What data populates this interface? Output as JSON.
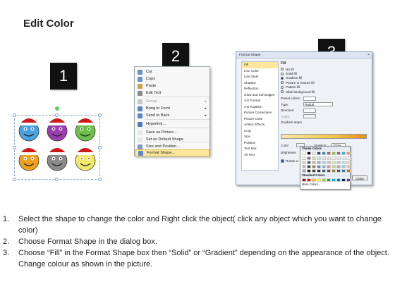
{
  "title": "Edit Color",
  "badges": [
    "1",
    "2",
    "3"
  ],
  "context_menu": {
    "items": [
      {
        "label": "Cut",
        "arrow": false,
        "disabled": false,
        "highlight": false,
        "icon_color": "#6b8fc7"
      },
      {
        "label": "Copy",
        "arrow": false,
        "disabled": false,
        "highlight": false,
        "icon_color": "#6b8fc7"
      },
      {
        "label": "Paste",
        "arrow": false,
        "disabled": false,
        "highlight": false,
        "icon_color": "#c9a34a"
      },
      {
        "label": "Edit Text",
        "arrow": false,
        "disabled": false,
        "highlight": false,
        "icon_color": "#8a8a8a"
      },
      {
        "label": "Group",
        "arrow": true,
        "disabled": true,
        "highlight": false,
        "icon_color": "#c8c8c8"
      },
      {
        "label": "Bring to Front",
        "arrow": true,
        "disabled": false,
        "highlight": false,
        "icon_color": "#5a86c5"
      },
      {
        "label": "Send to Back",
        "arrow": true,
        "disabled": false,
        "highlight": false,
        "icon_color": "#5a86c5"
      },
      {
        "label": "Hyperlink...",
        "arrow": false,
        "disabled": false,
        "highlight": false,
        "icon_color": "#4b7bc0"
      },
      {
        "label": "Save as Picture...",
        "arrow": false,
        "disabled": false,
        "highlight": false,
        "icon_color": "#e8e8e8"
      },
      {
        "label": "Set as Default Shape",
        "arrow": false,
        "disabled": false,
        "highlight": false,
        "icon_color": "#e8e8e8"
      },
      {
        "label": "Size and Position...",
        "arrow": false,
        "disabled": false,
        "highlight": false,
        "icon_color": "#7a9cc6"
      },
      {
        "label": "Format Shape...",
        "arrow": false,
        "disabled": false,
        "highlight": true,
        "icon_color": "#5b8bd2"
      }
    ]
  },
  "format_dialog": {
    "title": "Format Shape",
    "close": "×",
    "categories": [
      "Fill",
      "Line Color",
      "Line Style",
      "Shadow",
      "Reflection",
      "Glow and Soft Edges",
      "3-D Format",
      "3-D Rotation",
      "Picture Corrections",
      "Picture Color",
      "Artistic Effects",
      "Crop",
      "Size",
      "Position",
      "Text Box",
      "Alt Text"
    ],
    "active_category": "Fill",
    "section_heading": "Fill",
    "fill_options": [
      {
        "label": "No fill",
        "selected": false
      },
      {
        "label": "Solid fill",
        "selected": false
      },
      {
        "label": "Gradient fill",
        "selected": true
      },
      {
        "label": "Picture or texture fill",
        "selected": false
      },
      {
        "label": "Pattern fill",
        "selected": false
      },
      {
        "label": "Slide background fill",
        "selected": false
      }
    ],
    "preset_colors_label": "Preset colors:",
    "type_label": "Type:",
    "type_value": "Radial",
    "direction_label": "Direction:",
    "angle_label": "Angle:",
    "gradient_stops_label": "Gradient stops",
    "color_label": "Color",
    "position_label": "Position:",
    "position_value": "100%",
    "brightness_label": "Brightness",
    "rotate_label": "Rotate w",
    "close_button": "Close"
  },
  "color_palette": {
    "theme_header": "Theme Colors",
    "standard_header": "Standard Colors",
    "more_colors": "More Colors...",
    "theme_top": [
      "#ffffff",
      "#000000",
      "#eeece1",
      "#1f497d",
      "#4f81bd",
      "#c0504d",
      "#9bbb59",
      "#8064a2",
      "#4bacc6",
      "#f79646"
    ],
    "theme_shades": [
      [
        "#f2f2f2",
        "#7f7f7f",
        "#ddd9c3",
        "#c6d9f0",
        "#dbe5f1",
        "#f2dcdb",
        "#ebf1dd",
        "#e5e0ec",
        "#dbeef3",
        "#fdeada"
      ],
      [
        "#d8d8d8",
        "#595959",
        "#c4bd97",
        "#8db3e2",
        "#b8cce4",
        "#e5b9b7",
        "#d7e3bc",
        "#ccc1d9",
        "#b7dde8",
        "#fbd5b5"
      ],
      [
        "#bfbfbf",
        "#3f3f3f",
        "#938953",
        "#548dd4",
        "#95b3d7",
        "#d99694",
        "#c3d69b",
        "#b2a2c7",
        "#92cddc",
        "#fac08f"
      ],
      [
        "#a5a5a5",
        "#262626",
        "#494429",
        "#17365d",
        "#366092",
        "#953734",
        "#76923c",
        "#5f497a",
        "#31859b",
        "#e36c09"
      ]
    ],
    "standard": [
      "#c00000",
      "#ff0000",
      "#ffc000",
      "#ffff00",
      "#92d050",
      "#00b050",
      "#00b0f0",
      "#0070c0",
      "#002060",
      "#7030a0"
    ]
  },
  "smileys": [
    {
      "face": "#4aa3e0",
      "accent": "#1d5fa3"
    },
    {
      "face": "#9b3fb0",
      "accent": "#5a1a6e"
    },
    {
      "face": "#6cc04a",
      "accent": "#2e7d1e"
    },
    {
      "face": "#f0a020",
      "accent": "#a85d00"
    },
    {
      "face": "#8a8a8a",
      "accent": "#333333"
    },
    {
      "face": "#f2e86a",
      "accent": "#9a8b10"
    }
  ],
  "steps": [
    {
      "num": "1.",
      "text": "Select the shape to change the color and Right click the object( click any object which you want to change color)"
    },
    {
      "num": "2.",
      "text": "Choose Format Shape in the dialog box."
    },
    {
      "num": "3.",
      "text": "Choose “Fill” in the Format Shape box then “Solid” or “Gradient” depending on the appearance of the object. Change colour as shown in the picture."
    }
  ]
}
